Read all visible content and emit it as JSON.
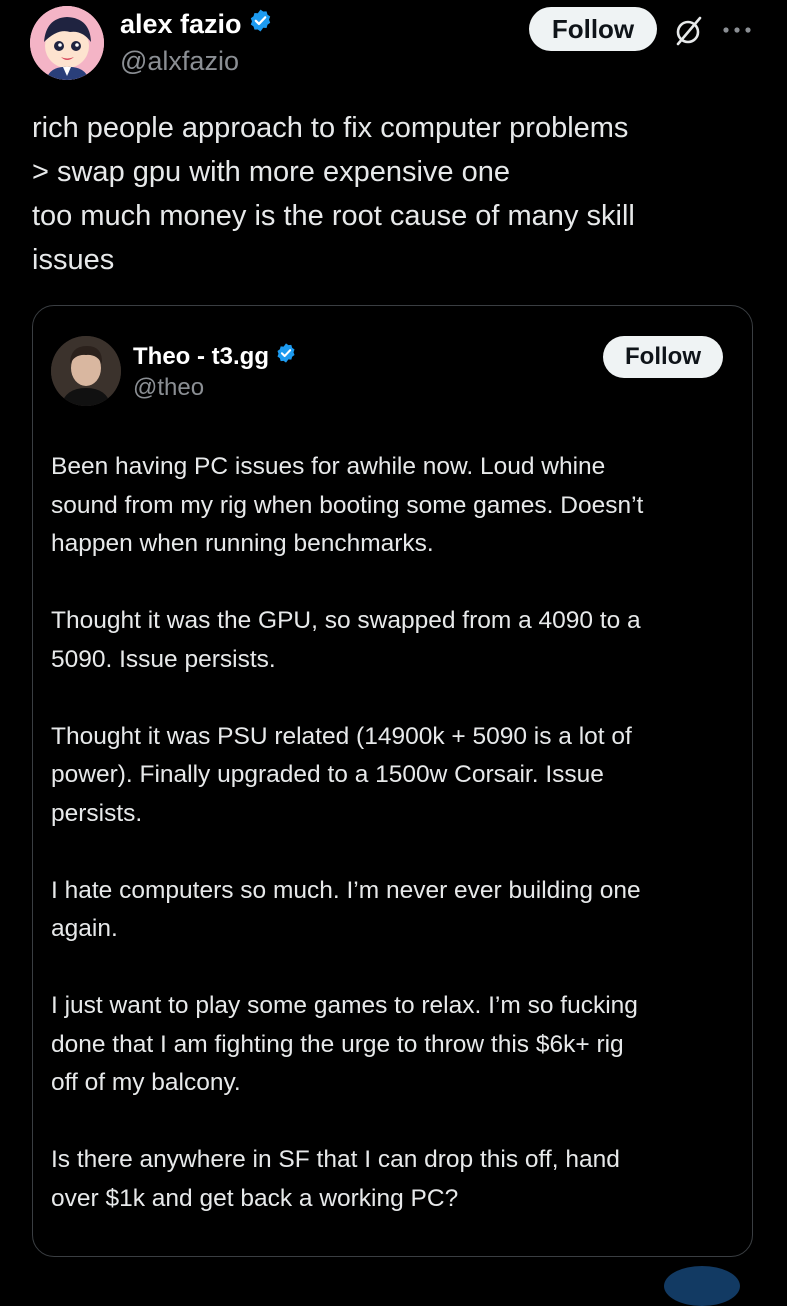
{
  "post": {
    "author": {
      "name": "alex fazio",
      "handle": "@alxfazio",
      "verified": true
    },
    "follow_label": "Follow",
    "icons": {
      "grok": "grok-icon",
      "more": "more-icon",
      "verified": "verified-badge-icon"
    },
    "text_lines": [
      "rich people approach to fix computer problems",
      "> swap gpu with more expensive one",
      "too much money is the root cause of many skill",
      "issues"
    ]
  },
  "quote": {
    "author": {
      "name": "Theo - t3.gg",
      "handle": "@theo",
      "verified": true
    },
    "follow_label": "Follow",
    "paragraphs": [
      [
        "Been having PC issues for awhile now. Loud whine",
        "sound from my rig when booting some games. Doesn’t",
        "happen when running benchmarks."
      ],
      [
        "Thought it was the GPU, so swapped from a 4090 to a",
        "5090. Issue persists."
      ],
      [
        "Thought it was PSU related (14900k + 5090 is a lot of",
        "power). Finally upgraded to a 1500w Corsair. Issue",
        "persists."
      ],
      [
        "I hate computers so much. I’m never ever building one",
        "again."
      ],
      [
        "I just want to play some games to relax. I’m so fucking",
        "done that I am fighting the urge to throw this $6k+ rig",
        "off of my balcony."
      ],
      [
        "Is there anywhere in SF that I can drop this off, hand",
        "over $1k and get back a working PC?"
      ]
    ]
  },
  "colors": {
    "background": "#000000",
    "text": "#e7e9ea",
    "secondary_text": "#8b8f94",
    "verified_blue": "#1d9bf0",
    "button_bg": "#eff3f4",
    "button_text": "#0f1419",
    "border": "#3a3e42"
  }
}
